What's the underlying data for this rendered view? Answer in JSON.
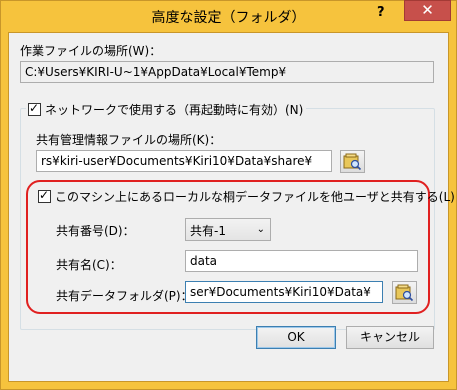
{
  "window": {
    "title": "高度な設定（フォルダ）",
    "help_label": "?",
    "close_label": "✕"
  },
  "workfile": {
    "label": "作業ファイルの場所(W)：",
    "value": "C:¥Users¥KIRI-U~1¥AppData¥Local¥Temp¥"
  },
  "network": {
    "checkbox_label": "ネットワークで使用する（再起動時に有効）(N)",
    "checked": true,
    "mgmt_label": "共有管理情報ファイルの場所(K)：",
    "mgmt_value": "rs¥kiri-user¥Documents¥Kiri10¥Data¥share¥",
    "share": {
      "checkbox_label": "このマシン上にあるローカルな桐データファイルを他ユーザと共有する(L)",
      "checked": true,
      "number_label": "共有番号(D)：",
      "number_value": "共有-1",
      "name_label": "共有名(C)：",
      "name_value": "data",
      "folder_label": "共有データフォルダ(P)：",
      "folder_value": "ser¥Documents¥Kiri10¥Data¥"
    }
  },
  "buttons": {
    "ok": "OK",
    "cancel": "キャンセル"
  },
  "colors": {
    "frame": "#f6c33d",
    "close": "#c7504b",
    "highlight_ring": "#e02020"
  }
}
